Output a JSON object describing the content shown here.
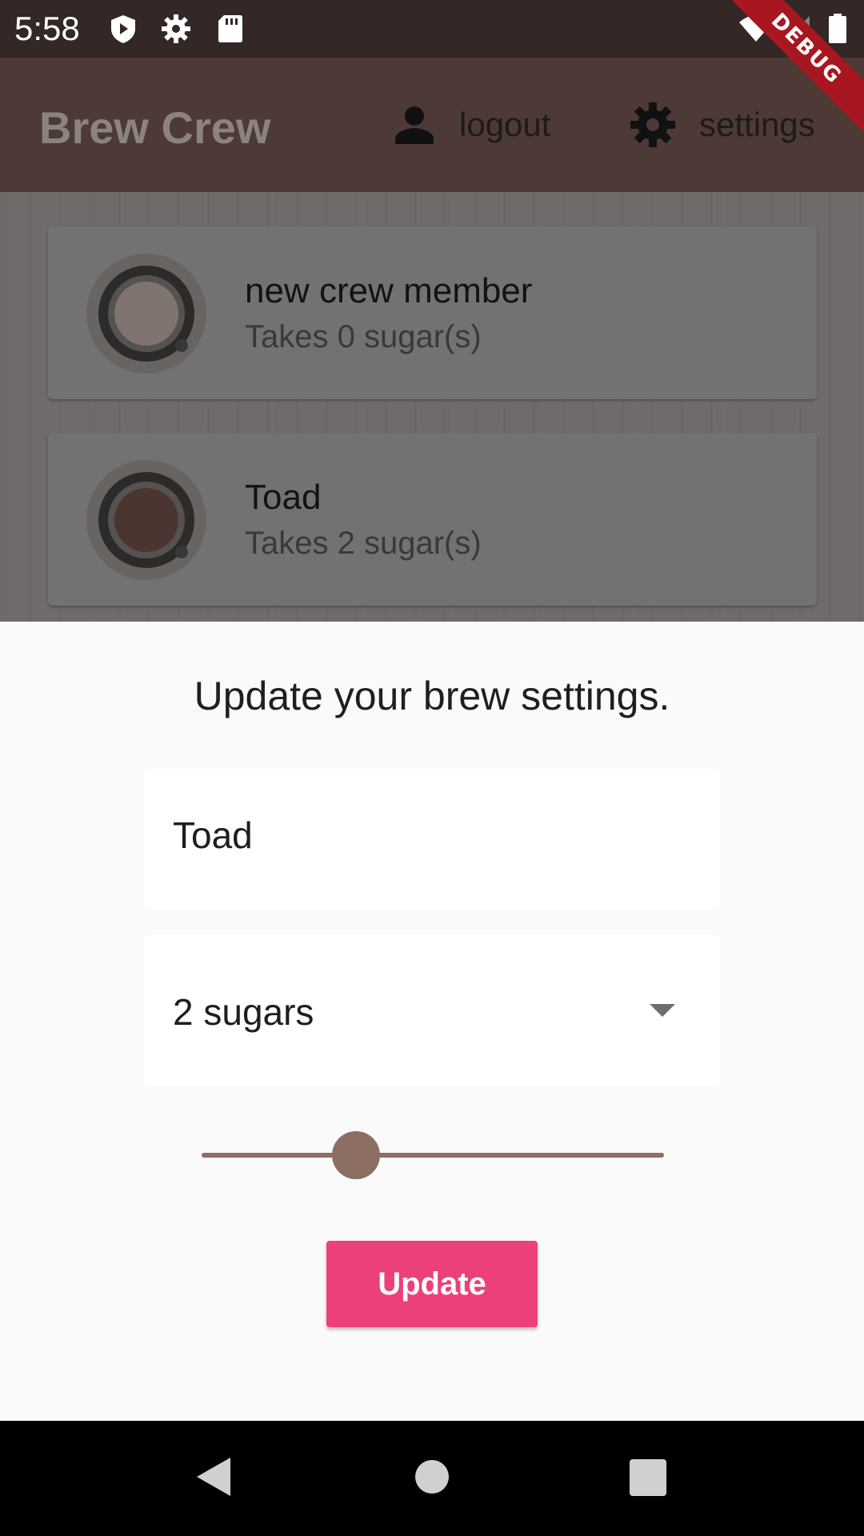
{
  "status_bar": {
    "time": "5:58",
    "left_icons": [
      "play-protect-icon",
      "gear-icon",
      "sd-card-icon"
    ],
    "right_icons": [
      "wifi-icon",
      "cell-signal-icon",
      "battery-icon"
    ]
  },
  "debug_banner": "DEBUG",
  "app_bar": {
    "title": "Brew Crew",
    "actions": [
      {
        "icon": "person-icon",
        "label": "logout"
      },
      {
        "icon": "settings-icon",
        "label": "settings"
      }
    ]
  },
  "brews": [
    {
      "name": "new crew member",
      "subtitle": "Takes 0 sugar(s)",
      "coffee_color": "#7f7470"
    },
    {
      "name": "Toad",
      "subtitle": "Takes 2 sugar(s)",
      "coffee_color": "#4a3530"
    }
  ],
  "settings_form": {
    "title": "Update your brew settings.",
    "name_value": "Toad",
    "sugars_selected": "2 sugars",
    "strength_slider": {
      "value_fraction": 0.33
    },
    "submit_label": "Update"
  },
  "colors": {
    "accent": "#ec407a",
    "slider": "#8d6e63",
    "app_bar": "#4d3a36"
  },
  "nav_bar": [
    "back-icon",
    "home-icon",
    "recents-icon"
  ]
}
